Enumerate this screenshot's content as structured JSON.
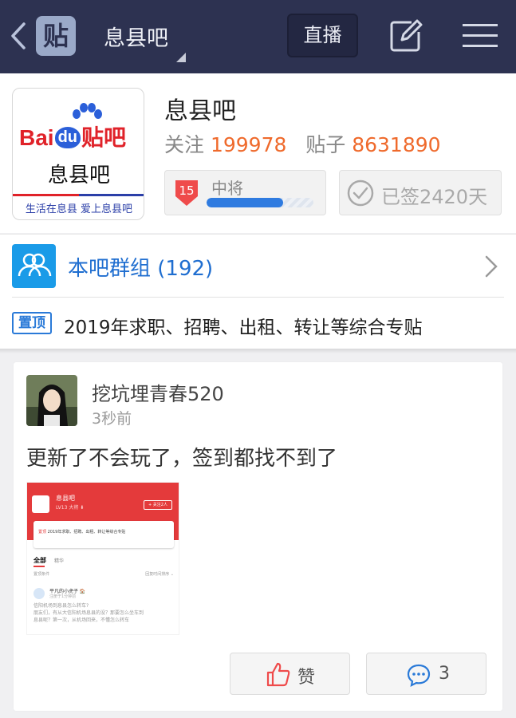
{
  "nav": {
    "tie_logo_char": "贴",
    "title": "息县吧",
    "live_label": "直播",
    "icons": [
      "back-arrow-icon",
      "compose-icon",
      "menu-icon"
    ]
  },
  "forum": {
    "logo": {
      "brand": "Bai",
      "brand_du": "du",
      "brand_suffix": "贴吧",
      "name": "息县吧",
      "slogan": "生活在息县  爱上息县吧"
    },
    "name": "息县吧",
    "follow_label": "关注",
    "follow_count": "199978",
    "posts_label": "贴子",
    "posts_count": "8631890",
    "level_num": "15",
    "level_name": "中将",
    "level_progress": 0.72,
    "signed_text": "已签2420天"
  },
  "group": {
    "label": "本吧群组 (192)"
  },
  "pinned": {
    "tag": "置顶",
    "text": "2019年求职、招聘、出租、转让等综合专贴"
  },
  "post": {
    "author": "挖坑埋青春520",
    "time": "3秒前",
    "text": "更新了不会玩了，签到都找不到了",
    "like_label": "赞",
    "comment_count": "3",
    "thumb": {
      "forum_name": "息县吧",
      "forum_sub": "LV13 大将 ⬇",
      "follow_btn": "+ 关注2人",
      "pin_tag": "置顶",
      "pin_text": "2019年求职、招聘、出租、转让等综合专贴",
      "tab_all": "全部",
      "tab_other": "精华",
      "sort_left": "置顶条件",
      "sort_right": "回复时间排序 ⌄",
      "user": "平凡的小虎子 🏠",
      "user_meta": "注册于1分钟前",
      "body": "信阳机场到息县怎么转车?\n朋友们，有从大信阳机场息县的没？那要怎么坐车到息县呢？第一次，从机场回来，不懂怎么转车"
    }
  },
  "colors": {
    "nav_bg": "#2d3251",
    "accent_blue": "#1f6ed0",
    "count_orange": "#ef6a2c",
    "baidu_red": "#e02229"
  }
}
